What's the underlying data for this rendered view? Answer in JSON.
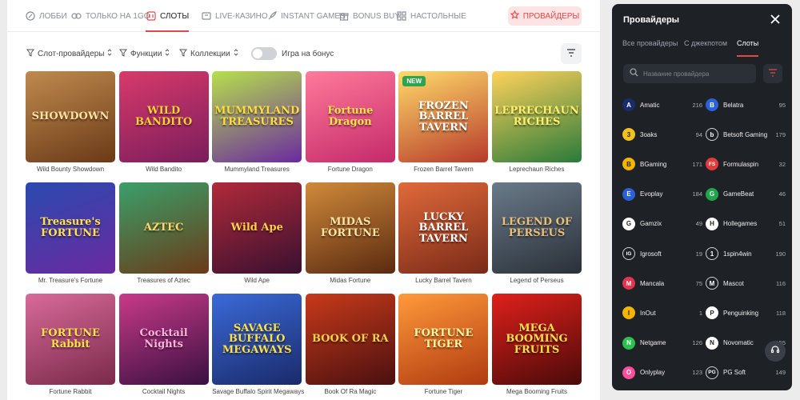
{
  "nav": {
    "items": [
      {
        "label": "ЛОББИ",
        "icon": "lobby-icon"
      },
      {
        "label": "ТОЛЬКО НА 1GO",
        "icon": "1go-icon"
      },
      {
        "label": "СЛОТЫ",
        "icon": "slot-icon",
        "active": true
      },
      {
        "label": "LIVE-КАЗИНО",
        "icon": "live-icon"
      },
      {
        "label": "INSTANT GAMES",
        "icon": "rocket-icon"
      },
      {
        "label": "BONUS BUY",
        "icon": "gift-icon"
      },
      {
        "label": "НАСТОЛЬНЫЕ",
        "icon": "table-games-icon"
      }
    ],
    "providers_button": "ПРОВАЙДЕРЫ",
    "accent_color": "#e0494a"
  },
  "filters": {
    "slot_providers": "Слот-провайдеры",
    "features": "Функции",
    "collections": "Коллекции",
    "bonus_toggle_label": "Игра на бонус",
    "bonus_toggle_on": false
  },
  "games": [
    {
      "title": "Wild Bounty Showdown",
      "art_text": "SHOWDOWN"
    },
    {
      "title": "Wild Bandito",
      "art_text": "WILD BANDITO"
    },
    {
      "title": "Mummyland Treasures",
      "art_text": "MUMMYLAND TREASURES"
    },
    {
      "title": "Fortune Dragon",
      "art_text": "Fortune Dragon"
    },
    {
      "title": "Frozen Barrel Tavern",
      "art_text": "FROZEN BARREL TAVERN",
      "badge": "NEW"
    },
    {
      "title": "Leprechaun Riches",
      "art_text": "LEPRECHAUN RICHES"
    },
    {
      "title": "Mr. Treasure's Fortune",
      "art_text": "Treasure's FORTUNE"
    },
    {
      "title": "Treasures of Aztec",
      "art_text": "AZTEC"
    },
    {
      "title": "Wild Ape",
      "art_text": "Wild Ape"
    },
    {
      "title": "Midas Fortune",
      "art_text": "MIDAS FORTUNE"
    },
    {
      "title": "Lucky Barrel Tavern",
      "art_text": "LUCKY BARREL TAVERN"
    },
    {
      "title": "Legend of Perseus",
      "art_text": "LEGEND OF PERSEUS"
    },
    {
      "title": "Fortune Rabbit",
      "art_text": "FORTUNE Rabbit"
    },
    {
      "title": "Cocktail Nights",
      "art_text": "Cocktail Nights"
    },
    {
      "title": "Savage Buffalo Spirit Megaways",
      "art_text": "SAVAGE BUFFALO MEGAWAYS"
    },
    {
      "title": "Book Of Ra Magic",
      "art_text": "BOOK OF RA"
    },
    {
      "title": "Fortune Tiger",
      "art_text": "FORTUNE TIGER"
    },
    {
      "title": "Mega Booming Fruits",
      "art_text": "MEGA BOOMING FRUITS"
    }
  ],
  "panel": {
    "title": "Провайдеры",
    "tabs": [
      "Все провайдеры",
      "С джекпотом",
      "Слоты"
    ],
    "active_tab": "Слоты",
    "search_placeholder": "Название провайдера",
    "providers": [
      {
        "name": "Amatic",
        "count": "216",
        "mark": "A",
        "color": "#1a2d6b"
      },
      {
        "name": "Belatra",
        "count": "95",
        "mark": "B",
        "color": "#2b62d9"
      },
      {
        "name": "3oaks",
        "count": "94",
        "mark": "3",
        "color": "#f2c020"
      },
      {
        "name": "Betsoft Gaming",
        "count": "179",
        "mark": "b",
        "color": "#1e2126"
      },
      {
        "name": "BGaming",
        "count": "171",
        "mark": "B",
        "color": "#f5b400"
      },
      {
        "name": "Formulaspin",
        "count": "32",
        "mark": "FS",
        "color": "#e33b3b"
      },
      {
        "name": "Evoplay",
        "count": "184",
        "mark": "E",
        "color": "#2a5fd8"
      },
      {
        "name": "GameBeat",
        "count": "46",
        "mark": "G",
        "color": "#1fa64a"
      },
      {
        "name": "Gamzix",
        "count": "49",
        "mark": "G",
        "color": "#ffffff"
      },
      {
        "name": "Hollegames",
        "count": "51",
        "mark": "H",
        "color": "#ffffff"
      },
      {
        "name": "Igrosoft",
        "count": "19",
        "mark": "IG",
        "color": "#1e2126"
      },
      {
        "name": "1spin4win",
        "count": "190",
        "mark": "1",
        "color": "#1e2126"
      },
      {
        "name": "Mancala",
        "count": "75",
        "mark": "M",
        "color": "#e8334f"
      },
      {
        "name": "Mascot",
        "count": "116",
        "mark": "M",
        "color": "#1e2126"
      },
      {
        "name": "InOut",
        "count": "1",
        "mark": "I",
        "color": "#f5b400"
      },
      {
        "name": "Penguinking",
        "count": "118",
        "mark": "P",
        "color": "#ffffff"
      },
      {
        "name": "Netgame",
        "count": "126",
        "mark": "N",
        "color": "#2cc14e"
      },
      {
        "name": "Novomatic",
        "count": "155",
        "mark": "N",
        "color": "#ffffff"
      },
      {
        "name": "Onlyplay",
        "count": "123",
        "mark": "O",
        "color": "#ff4e9a"
      },
      {
        "name": "PG Soft",
        "count": "149",
        "mark": "PG",
        "color": "#1e2126"
      }
    ]
  }
}
